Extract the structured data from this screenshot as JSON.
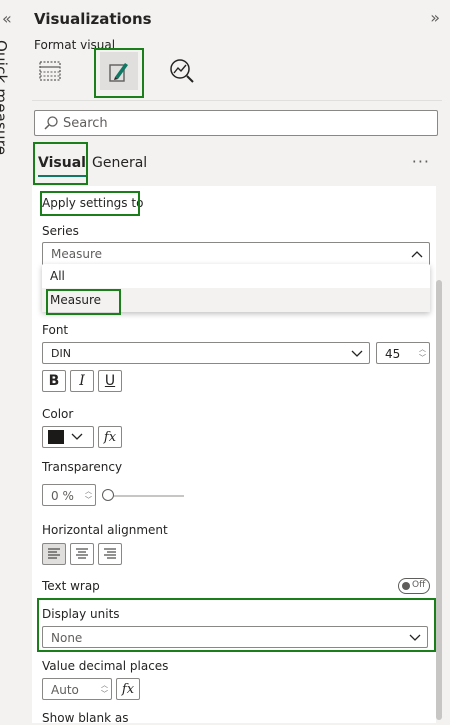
{
  "sidebar": {
    "collapse_glyph": "«",
    "label": "Quick measure"
  },
  "header": {
    "title": "Visualizations",
    "expand_glyph": "»",
    "format_visual_label": "Format visual"
  },
  "search": {
    "placeholder": "Search"
  },
  "tabs": {
    "visual": "Visual",
    "general": "General",
    "more": "···"
  },
  "apply_settings": {
    "heading": "Apply settings to",
    "series_label": "Series",
    "series_value": "Measure",
    "options": [
      "All",
      "Measure"
    ]
  },
  "font": {
    "label": "Font",
    "family": "DIN",
    "size": "45",
    "bold": "B",
    "italic": "I",
    "underline": "U"
  },
  "color": {
    "label": "Color",
    "swatch": "#1b1a19",
    "fx": "fx"
  },
  "transparency": {
    "label": "Transparency",
    "value": "0 %",
    "level": 0
  },
  "alignment": {
    "label": "Horizontal alignment"
  },
  "text_wrap": {
    "label": "Text wrap",
    "state": "Off"
  },
  "display_units": {
    "label": "Display units",
    "value": "None"
  },
  "decimal_places": {
    "label": "Value decimal places",
    "value": "Auto",
    "fx": "fx"
  },
  "show_blank": {
    "label": "Show blank as"
  },
  "colors": {
    "highlight": "#1a7f1a",
    "accent": "#117865"
  }
}
